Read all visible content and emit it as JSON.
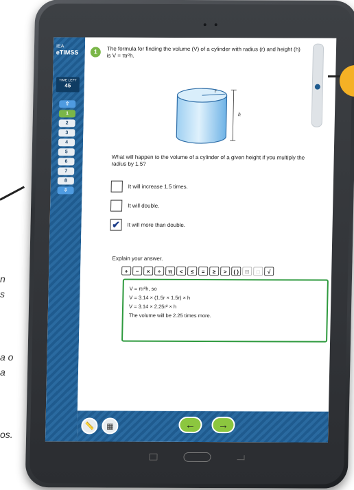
{
  "app": {
    "brand_small": "IEA",
    "brand": "eTIMSS"
  },
  "timer": {
    "label": "TIME LEFT",
    "value": "45"
  },
  "question_nav": {
    "up_arrow": "⇧",
    "items": [
      "1",
      "2",
      "3",
      "4",
      "5",
      "6",
      "7",
      "8"
    ],
    "active_index": 0,
    "down_arrow": "⇩"
  },
  "question": {
    "number": "1",
    "stem": "The formula for finding the volume (V) of a cylinder with radius (r) and height (h) is V = πr²h.",
    "figure_labels": {
      "radius": "r",
      "height": "h"
    },
    "prompt": "What will happen to the volume of a cylinder of a given height if you multiply the radius by 1.5?",
    "options": [
      {
        "label": "It will increase 1.5 times.",
        "checked": false
      },
      {
        "label": "It will double.",
        "checked": false
      },
      {
        "label": "It will more than double.",
        "checked": true
      }
    ],
    "explain_label": "Explain your answer."
  },
  "math_toolbar": [
    "+",
    "−",
    "×",
    "÷",
    "π",
    "<",
    "≤",
    "=",
    "≥",
    ">",
    "( )",
    "⊟",
    "□",
    "√"
  ],
  "answer_lines": [
    "V = πr²h, so",
    "V = 3.14 × (1.5r × 1.5r) × h",
    "V = 3.14 × 2.25r² × h",
    "The volume will be 2.25 times more."
  ],
  "bottom": {
    "ruler_icon": "ruler-icon",
    "calculator_icon": "calculator-icon",
    "back_arrow": "←",
    "next_arrow": "→"
  },
  "side_fragments": [
    "n",
    "s",
    "a o",
    "a",
    "os."
  ],
  "colors": {
    "nav_blue": "#1f5b8f",
    "accent_green": "#7ab648",
    "answer_border": "#2e9a3e",
    "callout_orange": "#f5b125"
  }
}
